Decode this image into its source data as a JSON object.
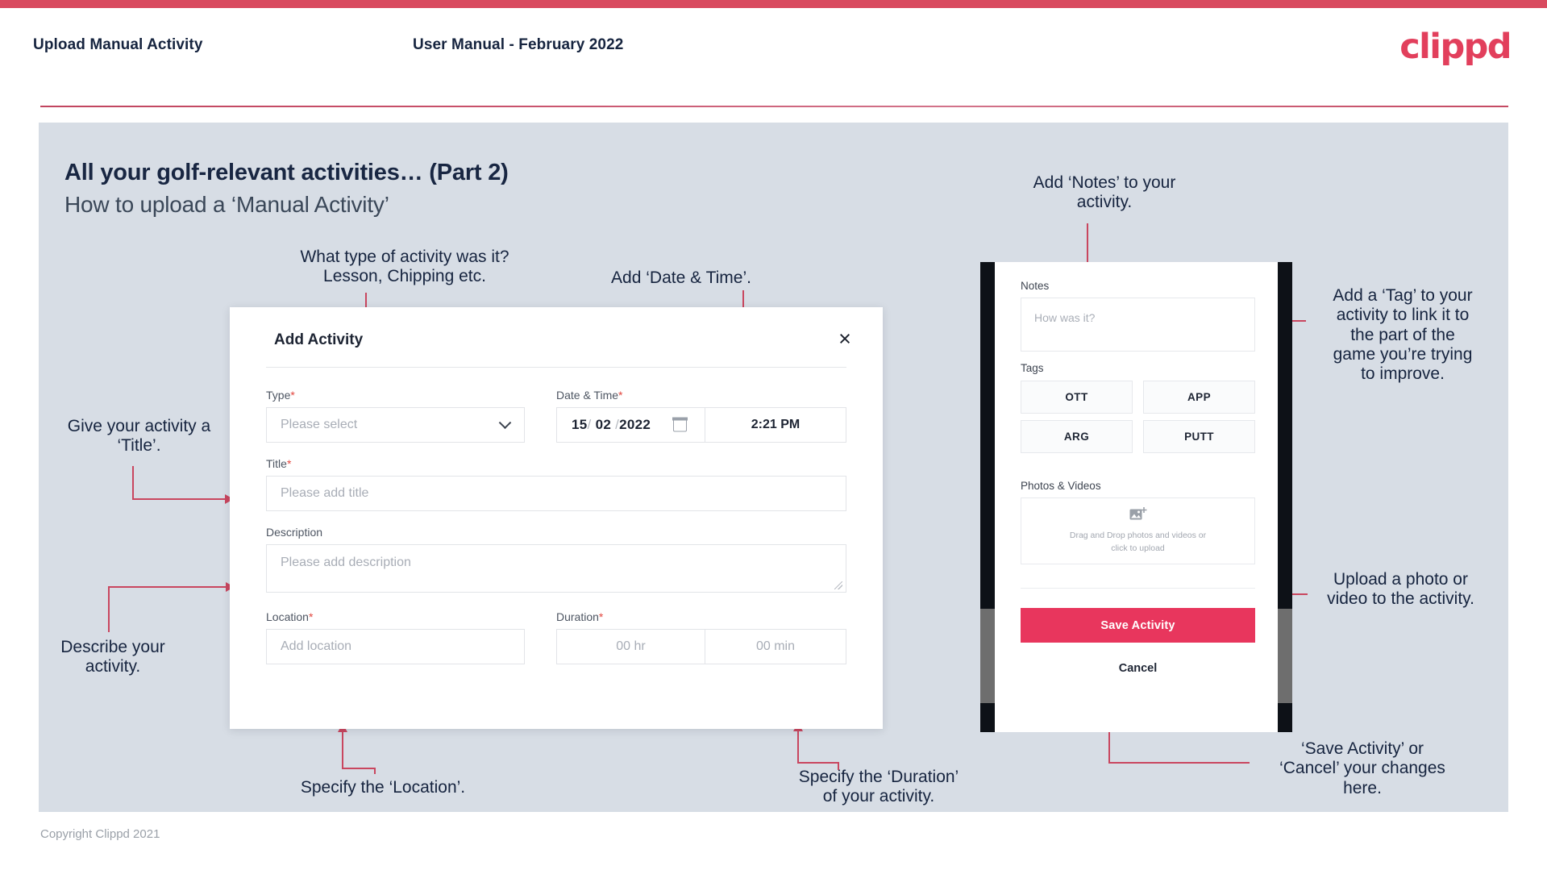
{
  "header": {
    "left_title": "Upload Manual Activity",
    "center_title": "User Manual - February 2022",
    "logo": "clippd"
  },
  "slide": {
    "title": "All your golf-relevant activities… (Part 2)",
    "subtitle": "How to upload a ‘Manual Activity’"
  },
  "annotations": {
    "type_note": "What type of activity was it?\nLesson, Chipping etc.",
    "datetime_note": "Add ‘Date & Time’.",
    "title_note": "Give your activity a\n‘Title’.",
    "description_note": "Describe your\nactivity.",
    "location_note": "Specify the ‘Location’.",
    "duration_note": "Specify the ‘Duration’\nof your activity.",
    "notes_note": "Add ‘Notes’ to your\nactivity.",
    "tag_note": "Add a ‘Tag’ to your\nactivity to link it to\nthe part of the\ngame you’re trying\nto improve.",
    "upload_note": "Upload a photo or\nvideo to the activity.",
    "save_note": "‘Save Activity’ or\n‘Cancel’ your changes\nhere."
  },
  "dialog": {
    "title": "Add Activity",
    "close_icon": "×",
    "fields": {
      "type_label": "Type",
      "type_value": "Please select",
      "datetime_label": "Date & Time",
      "date_day": "15",
      "date_month": "02",
      "date_year": "2022",
      "date_sep": "/",
      "time_value": "2:21 PM",
      "title_label": "Title",
      "title_placeholder": "Please add title",
      "description_label": "Description",
      "description_placeholder": "Please add description",
      "location_label": "Location",
      "location_placeholder": "Add location",
      "duration_label": "Duration",
      "duration_hours": "00 hr",
      "duration_minutes": "00 min"
    },
    "required_marker": "*"
  },
  "phone": {
    "notes_label": "Notes",
    "notes_placeholder": "How was it?",
    "tags_label": "Tags",
    "tags": [
      "OTT",
      "APP",
      "ARG",
      "PUTT"
    ],
    "photos_label": "Photos & Videos",
    "dropzone_text": "Drag and Drop photos and videos or\nclick to upload",
    "save_label": "Save Activity",
    "cancel_label": "Cancel"
  },
  "footer": {
    "copyright": "Copyright Clippd 2021"
  },
  "colors": {
    "brand_red": "#e23f5c",
    "accent_line": "#c9465f",
    "save_button": "#e8365d",
    "panel_bg": "#d7dde5",
    "text_dark": "#16243f"
  }
}
